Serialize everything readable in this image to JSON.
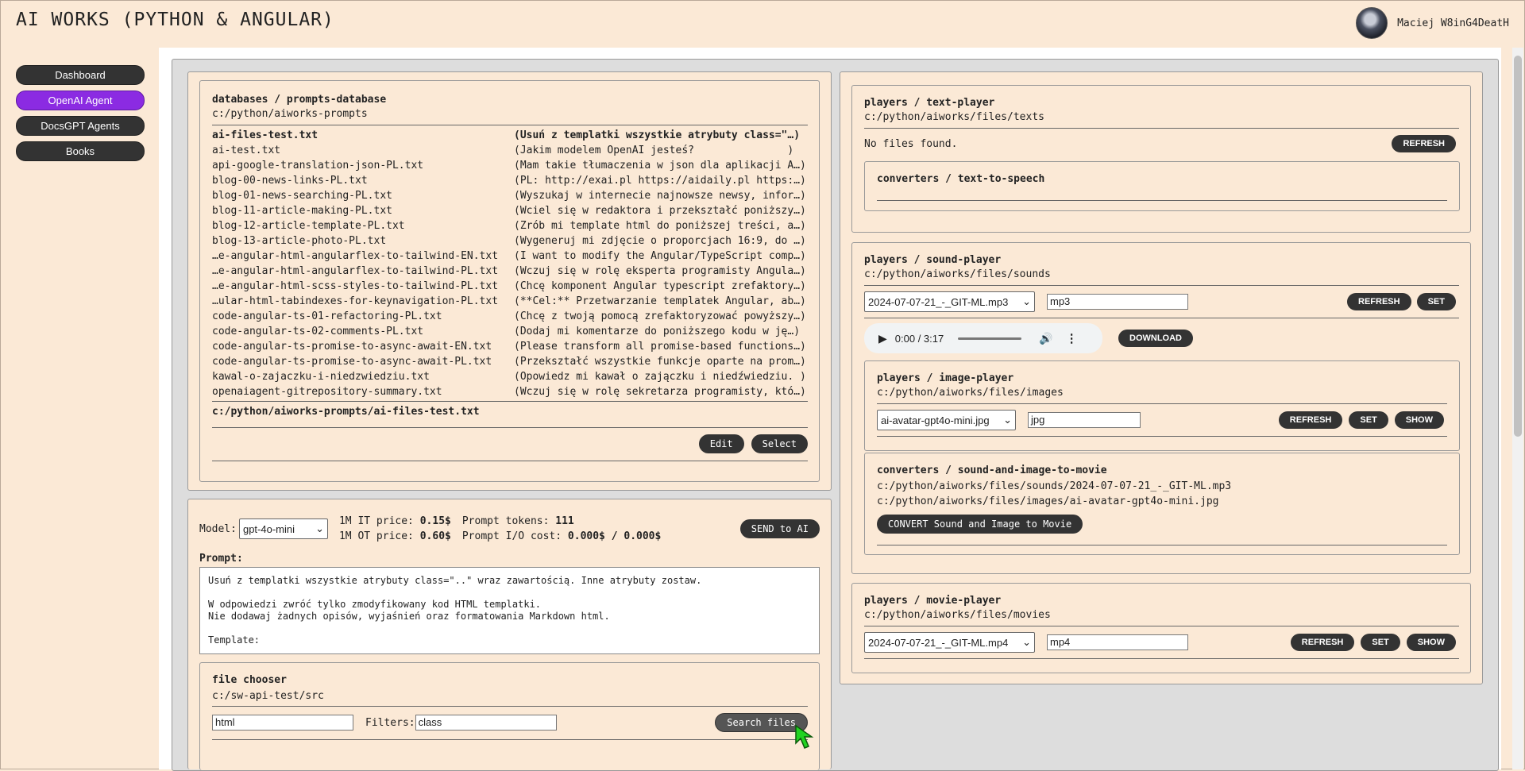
{
  "header": {
    "app_title": "AI WORKS (PYTHON & ANGULAR)",
    "user_name": "Maciej W8inG4DeatH"
  },
  "sidebar": {
    "items": [
      {
        "label": "Dashboard",
        "active": false
      },
      {
        "label": "OpenAI Agent",
        "active": true
      },
      {
        "label": "DocsGPT Agents",
        "active": false
      },
      {
        "label": "Books",
        "active": false
      }
    ]
  },
  "prompts_db": {
    "title": "databases / prompts-database",
    "path": "c:/python/aiworks-prompts",
    "files": [
      {
        "name": "ai-files-test.txt",
        "desc": "(Usuń z templatki wszystkie atrybuty class=\"…)",
        "selected": true
      },
      {
        "name": "ai-test.txt",
        "desc": "(Jakim modelem OpenAI jesteś?               )"
      },
      {
        "name": "api-google-translation-json-PL.txt",
        "desc": "(Mam takie tłumaczenia w json dla aplikacji A…)"
      },
      {
        "name": "blog-00-news-links-PL.txt",
        "desc": "(PL: http://exai.pl https://aidaily.pl https:…)"
      },
      {
        "name": "blog-01-news-searching-PL.txt",
        "desc": "(Wyszukaj w internecie najnowsze newsy, infor…)"
      },
      {
        "name": "blog-11-article-making-PL.txt",
        "desc": "(Wciel się w redaktora i przekształć poniższy…)"
      },
      {
        "name": "blog-12-article-template-PL.txt",
        "desc": "(Zrób mi template html do poniższej treści, a…)"
      },
      {
        "name": "blog-13-article-photo-PL.txt",
        "desc": "(Wygeneruj mi zdjęcie o proporcjach 16:9, do …)"
      },
      {
        "name": "…e-angular-html-angularflex-to-tailwind-EN.txt",
        "desc": "(I want to modify the Angular/TypeScript comp…)"
      },
      {
        "name": "…e-angular-html-angularflex-to-tailwind-PL.txt",
        "desc": "(Wczuj się w rolę eksperta programisty Angula…)"
      },
      {
        "name": "…e-angular-html-scss-styles-to-tailwind-PL.txt",
        "desc": "(Chcę komponent Angular typescript zrefaktory…)"
      },
      {
        "name": "…ular-html-tabindexes-for-keynavigation-PL.txt",
        "desc": "(**Cel:** Przetwarzanie templatek Angular, ab…)"
      },
      {
        "name": "code-angular-ts-01-refactoring-PL.txt",
        "desc": "(Chcę z twoją pomocą zrefaktoryzować powyższy…)"
      },
      {
        "name": "code-angular-ts-02-comments-PL.txt",
        "desc": "(Dodaj mi komentarze do poniższego kodu w ję…)"
      },
      {
        "name": "code-angular-ts-promise-to-async-await-EN.txt",
        "desc": "(Please transform all promise-based functions…)"
      },
      {
        "name": "code-angular-ts-promise-to-async-await-PL.txt",
        "desc": "(Przekształć wszystkie funkcje oparte na prom…)"
      },
      {
        "name": "kawal-o-zajaczku-i-niedzwiedziu.txt",
        "desc": "(Opowiedz mi kawał o zajączku i niedźwiedziu. )"
      },
      {
        "name": "openaiagent-gitrepository-summary.txt",
        "desc": "(Wczuj się w rolę sekretarza programisty, któ…)"
      }
    ],
    "selected_path": "c:/python/aiworks-prompts/ai-files-test.txt",
    "edit_label": "Edit",
    "select_label": "Select"
  },
  "model_panel": {
    "model_label": "Model:",
    "model_value": "gpt-4o-mini",
    "it_price_label": "1M IT price:",
    "it_price_value": "0.15$",
    "ot_price_label": "1M OT price:",
    "ot_price_value": "0.60$",
    "tokens_label": "Prompt tokens:",
    "tokens_value": "111",
    "cost_label": "Prompt I/O cost:",
    "cost_value": "0.000$ / 0.000$",
    "send_label": "SEND to AI",
    "prompt_label": "Prompt:",
    "prompt_lines": [
      "Usuń z templatki wszystkie atrybuty class=\"..\" wraz zawartością. Inne atrybuty zostaw.",
      "",
      "W odpowiedzi zwróć tylko zmodyfikowany kod HTML templatki.",
      "Nie dodawaj żadnych opisów, wyjaśnień oraz formatowania Markdown html.",
      "",
      "Template:"
    ]
  },
  "file_chooser": {
    "title": "file chooser",
    "path": "c:/sw-api-test/src",
    "ext_value": "html",
    "filters_label": "Filters:",
    "filters_value": "class",
    "search_label": "Search files"
  },
  "text_player": {
    "title": "players / text-player",
    "path": "c:/python/aiworks/files/texts",
    "status": "No files found.",
    "refresh_label": "REFRESH",
    "tts_title": "converters / text-to-speech"
  },
  "sound_player": {
    "title": "players / sound-player",
    "path": "c:/python/aiworks/files/sounds",
    "file_value": "2024-07-07-21_-_GIT-ML.mp3",
    "ext_value": "mp3",
    "refresh_label": "REFRESH",
    "set_label": "SET",
    "audio_time": "0:00 / 3:17",
    "download_label": "DOWNLOAD"
  },
  "image_player": {
    "title": "players / image-player",
    "path": "c:/python/aiworks/files/images",
    "file_value": "ai-avatar-gpt4o-mini.jpg",
    "ext_value": "jpg",
    "refresh_label": "REFRESH",
    "set_label": "SET",
    "show_label": "SHOW"
  },
  "movie_converter": {
    "title": "converters / sound-and-image-to-movie",
    "sound_path": "c:/python/aiworks/files/sounds/2024-07-07-21_-_GIT-ML.mp3",
    "image_path": "c:/python/aiworks/files/images/ai-avatar-gpt4o-mini.jpg",
    "convert_label": "CONVERT Sound and Image to Movie"
  },
  "movie_player": {
    "title": "players / movie-player",
    "path": "c:/python/aiworks/files/movies",
    "file_value": "2024-07-07-21_-_GIT-ML.mp4",
    "ext_value": "mp4",
    "refresh_label": "REFRESH",
    "set_label": "SET",
    "show_label": "SHOW"
  },
  "colors": {
    "accent": "#8b2be2",
    "background": "#fbe9d6",
    "button": "#333333"
  }
}
